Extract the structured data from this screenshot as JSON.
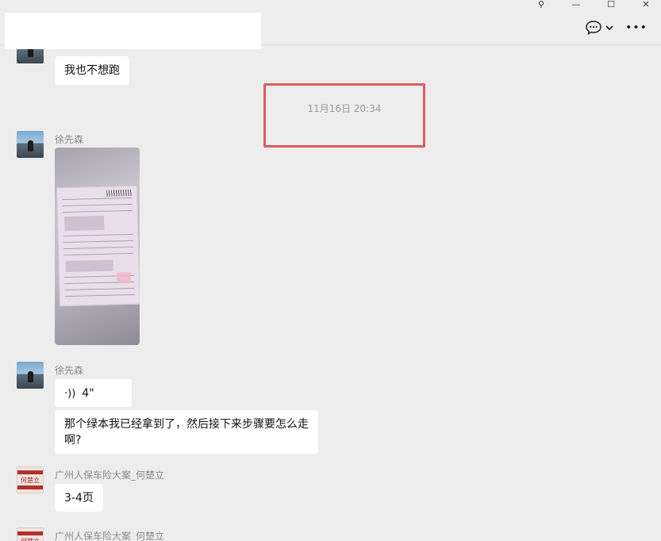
{
  "window": {
    "controls": {
      "pin": "⚲",
      "minimize": "—",
      "maximize": "☐",
      "close": "✕"
    }
  },
  "header": {
    "more_icon": "•••"
  },
  "messages": {
    "m1": {
      "text": "我也不想跑"
    },
    "timestamp": "11月16日 20:34",
    "m2": {
      "sender": "徐先森"
    },
    "m3": {
      "sender": "徐先森",
      "voice_icon": "·))",
      "voice_duration": "4\""
    },
    "m4": {
      "text": "那个绿本我已经拿到了，然后接下来步骤要怎么走啊?"
    },
    "m5": {
      "sender": "广州人保车险大案_何楚立",
      "text": "3-4页"
    },
    "m6": {
      "sender": "广州人保车险大案_何楚立"
    }
  },
  "avatars": {
    "agent_text": "何楚立"
  },
  "colors": {
    "background": "#ededed",
    "bubble": "#ffffff",
    "highlight": "#e25b5b",
    "meta_text": "#8a8a8a"
  }
}
